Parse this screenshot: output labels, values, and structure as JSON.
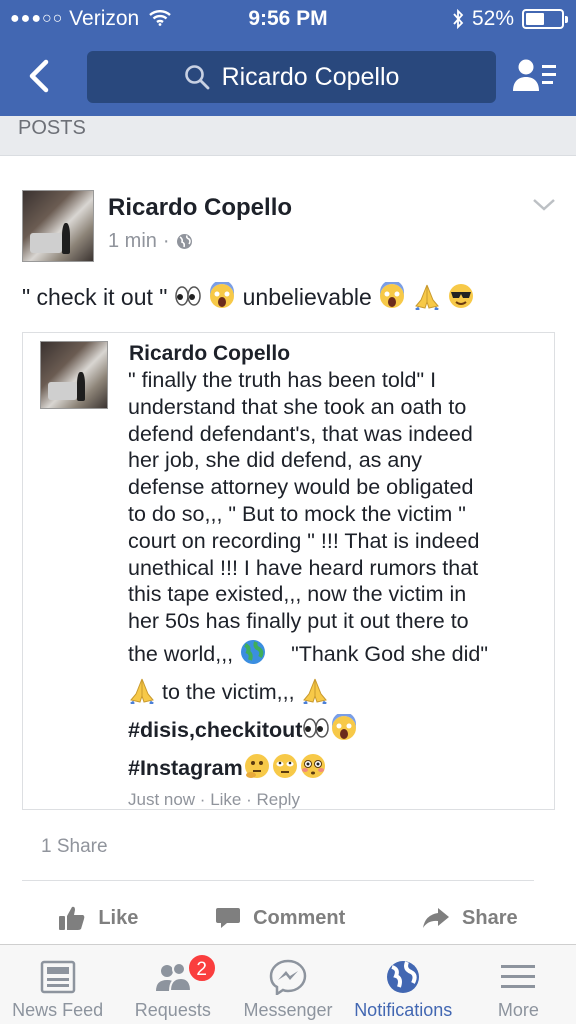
{
  "status_bar": {
    "signal_dots": "●●●○○",
    "carrier": "Verizon",
    "time": "9:56 PM",
    "battery_percent": "52%",
    "battery_level": 0.52
  },
  "nav": {
    "search_text": "Ricardo Copello"
  },
  "section_header": "POSTS",
  "post": {
    "author": "Ricardo Copello",
    "time": "1 min",
    "meta_sep": "·",
    "text_part1": "\" check it out \"",
    "text_part2": "unbelievable",
    "shared": {
      "author": "Ricardo Copello",
      "lines": [
        "\" finally the truth has been told\" I",
        "understand that she took an oath to",
        "defend defendant's, that was indeed",
        "her job, she did defend, as any",
        "defense attorney would be obligated",
        "to do so,,, \" But to mock the victim \"",
        "court on recording \" !!! That is indeed",
        "unethical !!!  I have heard rumors that",
        "this tape existed,,, now the victim in",
        "her 50s has finally put it out there to"
      ],
      "line_world": "the world,,,",
      "line_thank": "\"Thank God she did\"",
      "line_victim": "to the victim,,,",
      "tag1": "#disis",
      "tag1_rest": ",checkitout",
      "tag2": "#Instagram",
      "footer": "Just now · Like · Reply"
    },
    "share_count": "1 Share",
    "actions": {
      "like": "Like",
      "comment": "Comment",
      "share": "Share"
    }
  },
  "tabbar": {
    "tabs": [
      {
        "label": "News Feed",
        "icon": "news-feed-icon"
      },
      {
        "label": "Requests",
        "icon": "friend-requests-icon",
        "badge": "2"
      },
      {
        "label": "Messenger",
        "icon": "messenger-icon"
      },
      {
        "label": "Notifications",
        "icon": "globe-icon"
      },
      {
        "label": "More",
        "icon": "menu-icon"
      }
    ],
    "active": "Notifications"
  },
  "colors": {
    "brand": "#4267b2",
    "search_bg": "#29487d",
    "badge": "#fa3e3e"
  }
}
